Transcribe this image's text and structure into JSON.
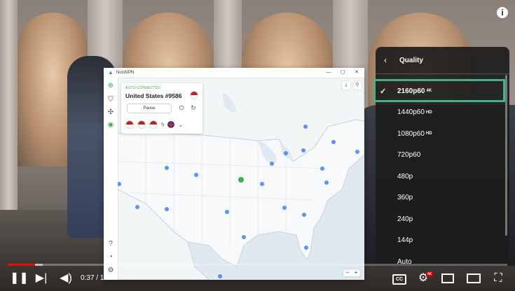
{
  "overlay": {
    "info_icon": "i"
  },
  "nordvpn": {
    "app_title": "NordVPN",
    "status": "AUTO-CONNECTED",
    "server": "United States #9586",
    "pause_label": "Pause",
    "zoom_out": "−",
    "zoom_in": "+"
  },
  "quality_menu": {
    "title": "Quality",
    "options": [
      {
        "label": "2160p60",
        "badge": "4K",
        "selected": true
      },
      {
        "label": "1440p60",
        "badge": "HD"
      },
      {
        "label": "1080p60",
        "badge": "HD"
      },
      {
        "label": "720p60",
        "badge": ""
      },
      {
        "label": "480p",
        "badge": ""
      },
      {
        "label": "360p",
        "badge": ""
      },
      {
        "label": "240p",
        "badge": ""
      },
      {
        "label": "144p",
        "badge": ""
      },
      {
        "label": "Auto",
        "badge": ""
      }
    ],
    "highlight_color": "#3fb28e"
  },
  "player": {
    "time": "0:37 / 1",
    "cc_label": "CC",
    "settings_badge": "4K",
    "progress_color": "#ff0000",
    "played_fraction": 0.055
  }
}
